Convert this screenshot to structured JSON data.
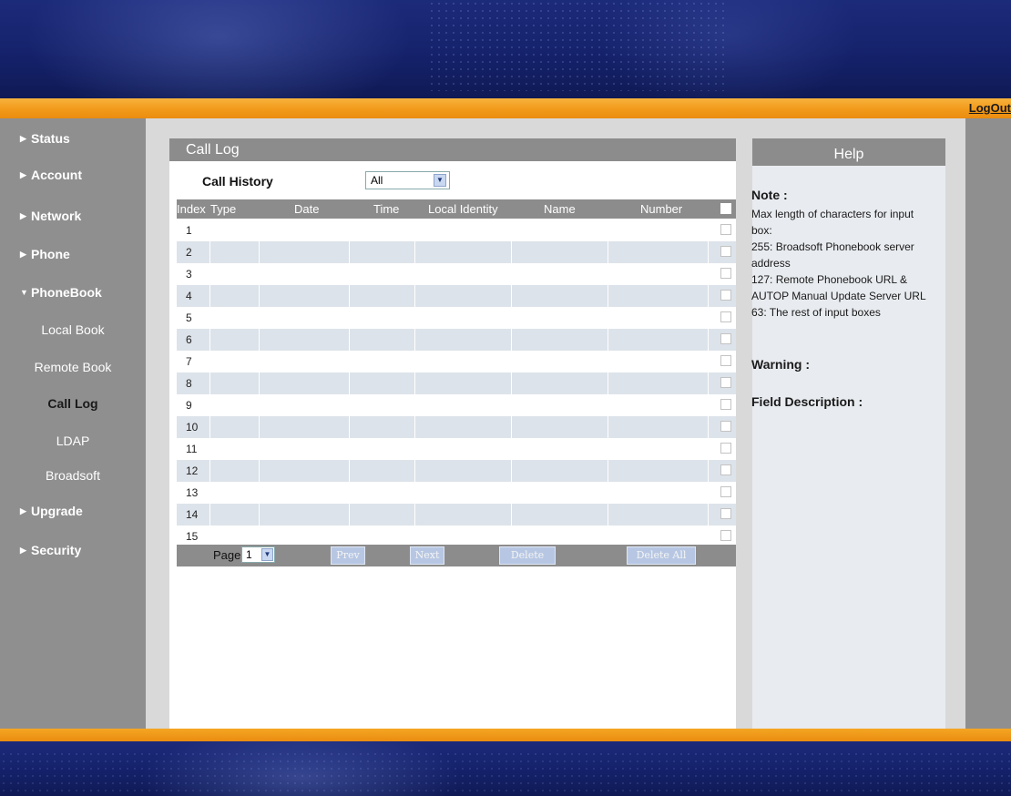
{
  "header": {
    "logout_label": "LogOut"
  },
  "sidebar": {
    "items": [
      {
        "label": "Status"
      },
      {
        "label": "Account"
      },
      {
        "label": "Network"
      },
      {
        "label": "Phone"
      },
      {
        "label": "PhoneBook"
      },
      {
        "label": "Upgrade"
      },
      {
        "label": "Security"
      }
    ],
    "phonebook_subitems": [
      {
        "label": "Local Book",
        "active": false
      },
      {
        "label": "Remote Book",
        "active": false
      },
      {
        "label": "Call Log",
        "active": true
      },
      {
        "label": "LDAP",
        "active": false
      },
      {
        "label": "Broadsoft",
        "active": false
      }
    ]
  },
  "main": {
    "title": "Call Log",
    "call_history_label": "Call History",
    "filter_value": "All",
    "columns": [
      "Index",
      "Type",
      "Date",
      "Time",
      "Local Identity",
      "Name",
      "Number"
    ],
    "rows": [
      "1",
      "2",
      "3",
      "4",
      "5",
      "6",
      "7",
      "8",
      "9",
      "10",
      "11",
      "12",
      "13",
      "14",
      "15"
    ],
    "pager": {
      "page_label": "Page",
      "page_value": "1",
      "prev_label": "Prev",
      "next_label": "Next",
      "delete_label": "Delete",
      "delete_all_label": "Delete All"
    }
  },
  "help": {
    "title": "Help",
    "note_title": "Note :",
    "note_lines": [
      "Max length of characters for input",
      "box:",
      "255: Broadsoft Phonebook server",
      "address",
      "127: Remote Phonebook URL &",
      "AUTOP Manual Update Server URL",
      "63: The rest of input boxes"
    ],
    "warning_title": "Warning :",
    "field_description_title": "Field Description :"
  },
  "icons": {
    "nav_collapsed": "triangle-right-icon",
    "nav_expanded": "triangle-down-icon",
    "dropdown": "chevron-down-icon"
  },
  "colors": {
    "accent_orange": "#f29a1a",
    "banner_blue": "#15226b",
    "sidebar_gray": "#8f8f8f",
    "header_gray": "#8c8c8c"
  }
}
